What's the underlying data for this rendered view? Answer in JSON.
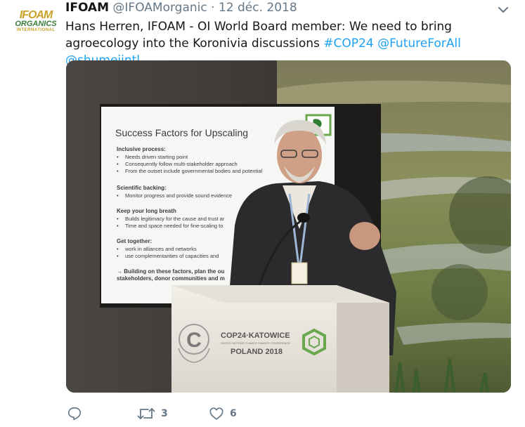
{
  "tweet": {
    "avatar": {
      "line1": "IFOAM",
      "line2": "ORGANICS",
      "line3": "INTERNATIONAL"
    },
    "author_name": "IFOAM",
    "handle": "@IFOAMorganic",
    "separator": "·",
    "date": "12 déc. 2018",
    "text_plain": "Hans Herren, IFOAM - OI World Board member: We need to bring agroecology into the Koronivia discussions ",
    "hashtags": [
      "#COP24",
      "@FutureForAll",
      "@shumeiintl"
    ]
  },
  "slide": {
    "title": "Success Factors for Upscaling",
    "sections": [
      {
        "heading": "Inclusive process:",
        "bullets": [
          "Needs driven starting point",
          "Consequently follow multi-stakeholder approach",
          "From the outset include governmental bodies and potential"
        ]
      },
      {
        "heading": "Scientific backing:",
        "bullets": [
          "Monitor progress and provide sound evidence"
        ]
      },
      {
        "heading": "Keep your long breath",
        "bullets": [
          "Builds legitimacy for the cause and trust ar",
          "Time and space needed for fine-scaling to"
        ]
      },
      {
        "heading": "Get together:",
        "bullets": [
          "work in alliances and networks",
          "use complementarities of capacities and"
        ]
      }
    ],
    "footer_line1": "→ Building on these factors, plan the ou",
    "footer_line2": "stakeholders, donor communities and m"
  },
  "podium": {
    "line1": "COP24·KATOWICE",
    "line2": "UNITED NATIONS CLIMATE CHANGE CONFERENCE",
    "line3": "POLAND 2018"
  },
  "actions": {
    "reply_count": "",
    "retweet_count": "3",
    "like_count": "6"
  },
  "colors": {
    "link": "#1da1f2",
    "secondary": "#657786",
    "primary": "#14171a"
  },
  "icons": [
    "ifoam-logo",
    "chevron-down-icon",
    "reply-icon",
    "retweet-icon",
    "heart-icon"
  ]
}
